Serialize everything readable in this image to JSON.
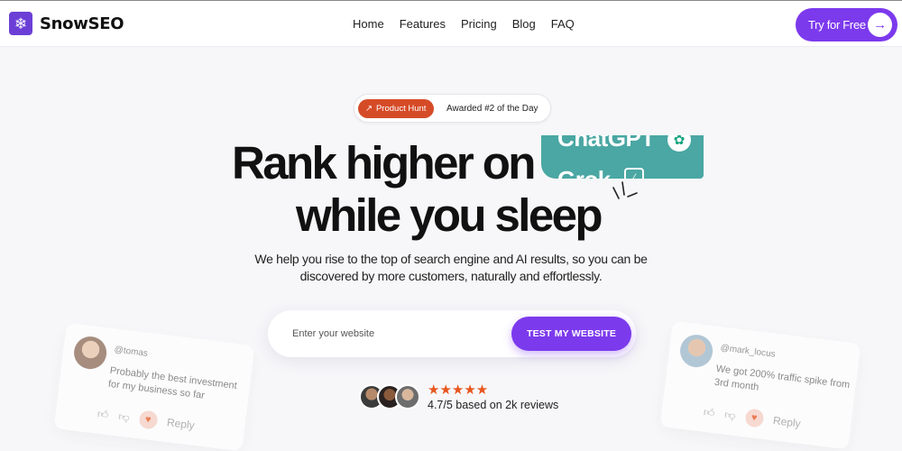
{
  "brand": {
    "name": "SnowSEO",
    "logo_icon": "snowflake-icon",
    "accent": "#7c3aed"
  },
  "nav": {
    "links": [
      "Home",
      "Features",
      "Pricing",
      "Blog",
      "FAQ"
    ],
    "cta_label": "Try for Free",
    "cta_icon": "arrow-right-icon"
  },
  "badge": {
    "source": "Product Hunt",
    "text": "Awarded #2 of the Day",
    "source_color": "#d64b27"
  },
  "hero": {
    "line1": "Rank higher on",
    "line2": "while you sleep",
    "rotating_words": [
      "ChatGPT",
      "Grok"
    ],
    "subtitle": "We help you rise to the top of search engine and AI results, so you can be discovered by more customers, naturally and effortlessly."
  },
  "search": {
    "placeholder": "Enter your website",
    "value": "",
    "button_label": "TEST MY WEBSITE"
  },
  "reviews": {
    "stars": "★★★★★",
    "star_count": 5,
    "summary": "4.7/5 based on 2k reviews"
  },
  "testimonials": [
    {
      "handle": "@tomas",
      "text": "Probably the best investment for my business so far",
      "reply_label": "Reply"
    },
    {
      "handle": "@mark_locus",
      "text": "We got 200% traffic spike from 3rd month",
      "reply_label": "Reply"
    }
  ]
}
